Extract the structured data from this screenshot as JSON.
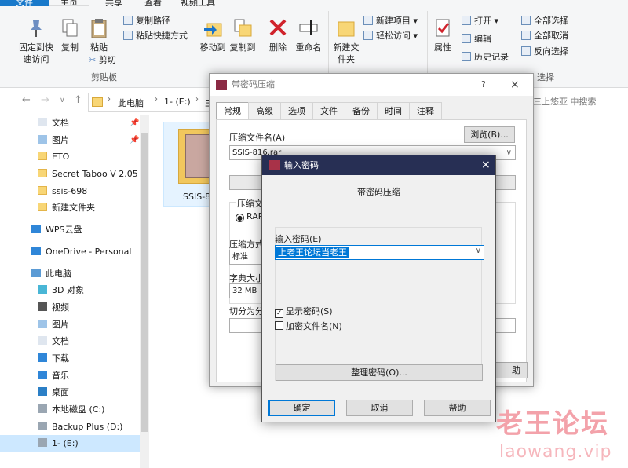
{
  "ribbon": {
    "tabs": [
      "文件",
      "主页",
      "共享",
      "查看",
      "视频工具"
    ],
    "clipboard": {
      "pin_quick_access": "固定到快速访问",
      "copy": "复制",
      "paste": "粘贴",
      "copy_path": "复制路径",
      "paste_shortcut": "粘贴快捷方式",
      "cut": "剪切",
      "group": "剪贴板"
    },
    "organize": {
      "move_to": "移动到",
      "copy_to": "复制到",
      "delete": "删除",
      "rename": "重命名"
    },
    "new": {
      "new_folder": "新建文件夹",
      "new_item": "新建项目",
      "easy_access": "轻松访问"
    },
    "open": {
      "properties": "属性",
      "open": "打开",
      "edit": "编辑",
      "history": "历史记录"
    },
    "select": {
      "select_all": "全部选择",
      "select_none": "全部取消",
      "invert": "反向选择",
      "group": "选择"
    }
  },
  "navigation": {
    "breadcrumb": [
      "此电脑",
      "1- (E:)",
      "三"
    ],
    "search_placeholder": "三上悠亚 中搜索"
  },
  "sidebar": {
    "items": [
      {
        "label": "文档",
        "icon": "documents-icon",
        "pinned": true
      },
      {
        "label": "图片",
        "icon": "pictures-icon",
        "pinned": true
      },
      {
        "label": "ETO",
        "icon": "folder-icon"
      },
      {
        "label": "Secret Taboo V 2.05",
        "icon": "folder-icon"
      },
      {
        "label": "ssis-698",
        "icon": "folder-icon"
      },
      {
        "label": "新建文件夹",
        "icon": "folder-icon"
      },
      {
        "label": "WPS云盘",
        "icon": "cloud-icon"
      },
      {
        "label": "OneDrive - Personal",
        "icon": "cloud-icon"
      },
      {
        "label": "此电脑",
        "icon": "computer-icon"
      },
      {
        "label": "3D 对象",
        "icon": "3d-objects-icon"
      },
      {
        "label": "视频",
        "icon": "videos-icon"
      },
      {
        "label": "图片",
        "icon": "pictures-icon"
      },
      {
        "label": "文档",
        "icon": "documents-icon"
      },
      {
        "label": "下载",
        "icon": "downloads-icon"
      },
      {
        "label": "音乐",
        "icon": "music-icon"
      },
      {
        "label": "桌面",
        "icon": "desktop-icon"
      },
      {
        "label": "本地磁盘 (C:)",
        "icon": "drive-icon"
      },
      {
        "label": "Backup Plus (D:)",
        "icon": "drive-icon"
      },
      {
        "label": "1- (E:)",
        "icon": "drive-icon",
        "selected": true
      }
    ]
  },
  "file_item": {
    "name": "SSIS-8"
  },
  "archive_dialog": {
    "title": "带密码压缩",
    "tabs": [
      "常规",
      "高级",
      "选项",
      "文件",
      "备份",
      "时间",
      "注释"
    ],
    "archive_name_label": "压缩文件名(A)",
    "archive_name_value": "SSIS-816.rar",
    "browse_button": "浏览(B)...",
    "format_label": "压缩文",
    "format_option": "RAR",
    "method_label": "压缩方式",
    "method_value": "标准",
    "dict_label": "字典大小",
    "dict_value": "32 MB",
    "split_label": "切分为分",
    "help_fragment": "助"
  },
  "password_dialog": {
    "title": "输入密码",
    "heading": "带密码压缩",
    "password_label": "输入密码(E)",
    "password_value": "上老王论坛当老王",
    "show_password": "显示密码(S)",
    "show_password_checked": true,
    "encrypt_names": "加密文件名(N)",
    "encrypt_names_checked": false,
    "organize_button": "整理密码(O)...",
    "ok_button": "确定",
    "cancel_button": "取消",
    "help_button": "帮助"
  },
  "watermark": {
    "text": "老王论坛",
    "url": "laowang.vip"
  }
}
